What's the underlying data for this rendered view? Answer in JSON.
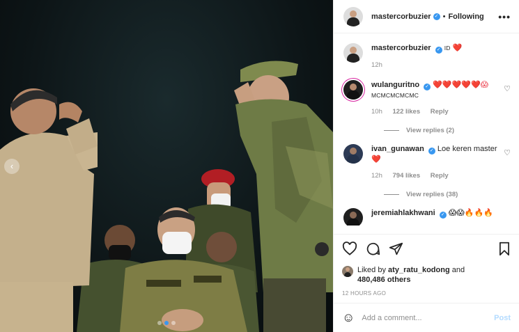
{
  "post": {
    "username": "mastercorbuzier",
    "follow_separator": "•",
    "follow_label": "Following",
    "more_label": "•••"
  },
  "caption": {
    "username": "mastercorbuzier",
    "text": "ID",
    "emoji": "❤️",
    "time": "12h"
  },
  "comments": [
    {
      "username": "wulanguritno",
      "emoji": "❤️❤️❤️❤️❤️😱",
      "text": "MCMCMCMCMC",
      "time": "10h",
      "likes": "122 likes",
      "reply": "Reply",
      "view_replies": "View replies (2)"
    },
    {
      "username": "ivan_gunawan",
      "text": "Loe keren master",
      "emoji": "❤️",
      "time": "12h",
      "likes": "794 likes",
      "reply": "Reply",
      "view_replies": "View replies (38)"
    },
    {
      "username": "jeremiahlakhwani",
      "emoji": "😱😱🔥🔥🔥"
    }
  ],
  "likes": {
    "prefix": "Liked by",
    "user": "aty_ratu_kodong",
    "and": "and",
    "others": "480,486 others"
  },
  "timestamp": "12 HOURS AGO",
  "add_comment": {
    "placeholder": "Add a comment...",
    "post_label": "Post"
  },
  "icons": {
    "verified": "✓",
    "nav_left": "‹",
    "emoji": "☺",
    "heart_outline": "♡"
  },
  "colors": {
    "link_blue": "#3897f0",
    "heart_red": "#ed4956",
    "muted": "#8e8e8e"
  }
}
